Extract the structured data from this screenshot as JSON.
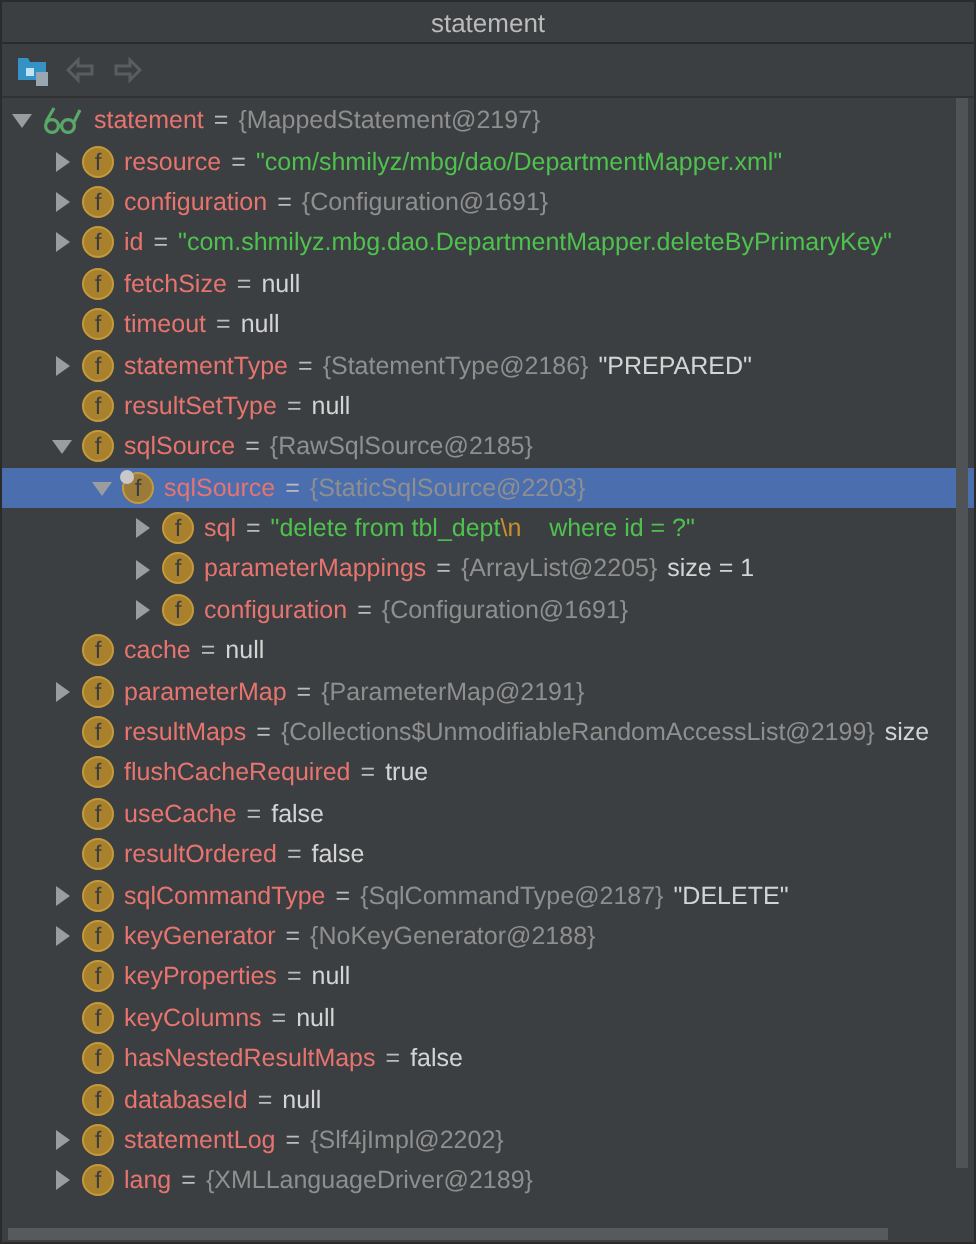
{
  "window": {
    "title": "statement"
  },
  "toolbar": {
    "buttons": [
      {
        "kind": "frames",
        "disabled": false
      },
      {
        "kind": "back",
        "disabled": true
      },
      {
        "kind": "forward",
        "disabled": true
      }
    ]
  },
  "tree": {
    "items": [
      {
        "kind": "node",
        "expanded": true,
        "selected": false,
        "icon": {
          "kind": "watch"
        },
        "parts": [
          {
            "kind": "name",
            "text": "statement"
          },
          {
            "kind": "op",
            "text": "="
          },
          {
            "kind": "ref",
            "text": "{MappedStatement@2197}"
          }
        ],
        "children": [
          {
            "kind": "node",
            "expanded": false,
            "selected": false,
            "icon": {
              "kind": "field",
              "letter": "f"
            },
            "parts": [
              {
                "kind": "name",
                "text": "resource"
              },
              {
                "kind": "op",
                "text": "="
              },
              {
                "kind": "string",
                "text": "\"com/shmilyz/mbg/dao/DepartmentMapper.xml\""
              }
            ]
          },
          {
            "kind": "node",
            "expanded": false,
            "selected": false,
            "icon": {
              "kind": "field",
              "letter": "f"
            },
            "parts": [
              {
                "kind": "name",
                "text": "configuration"
              },
              {
                "kind": "op",
                "text": "="
              },
              {
                "kind": "ref",
                "text": "{Configuration@1691}"
              }
            ]
          },
          {
            "kind": "node",
            "expanded": false,
            "selected": false,
            "icon": {
              "kind": "field",
              "letter": "f"
            },
            "parts": [
              {
                "kind": "name",
                "text": "id"
              },
              {
                "kind": "op",
                "text": "="
              },
              {
                "kind": "string",
                "text": "\"com.shmilyz.mbg.dao.DepartmentMapper.deleteByPrimaryKey\""
              }
            ]
          },
          {
            "kind": "leaf",
            "selected": false,
            "icon": {
              "kind": "field",
              "letter": "f"
            },
            "parts": [
              {
                "kind": "name",
                "text": "fetchSize"
              },
              {
                "kind": "op",
                "text": "="
              },
              {
                "kind": "literal",
                "text": "null"
              }
            ]
          },
          {
            "kind": "leaf",
            "selected": false,
            "icon": {
              "kind": "field",
              "letter": "f"
            },
            "parts": [
              {
                "kind": "name",
                "text": "timeout"
              },
              {
                "kind": "op",
                "text": "="
              },
              {
                "kind": "literal",
                "text": "null"
              }
            ]
          },
          {
            "kind": "node",
            "expanded": false,
            "selected": false,
            "icon": {
              "kind": "field",
              "letter": "f"
            },
            "parts": [
              {
                "kind": "name",
                "text": "statementType"
              },
              {
                "kind": "op",
                "text": "="
              },
              {
                "kind": "ref",
                "text": "{StatementType@2186}"
              },
              {
                "kind": "literal",
                "text": "\"PREPARED\""
              }
            ]
          },
          {
            "kind": "leaf",
            "selected": false,
            "icon": {
              "kind": "field",
              "letter": "f"
            },
            "parts": [
              {
                "kind": "name",
                "text": "resultSetType"
              },
              {
                "kind": "op",
                "text": "="
              },
              {
                "kind": "literal",
                "text": "null"
              }
            ]
          },
          {
            "kind": "node",
            "expanded": true,
            "selected": false,
            "icon": {
              "kind": "field",
              "letter": "f"
            },
            "parts": [
              {
                "kind": "name",
                "text": "sqlSource"
              },
              {
                "kind": "op",
                "text": "="
              },
              {
                "kind": "ref",
                "text": "{RawSqlSource@2185}"
              }
            ],
            "children": [
              {
                "kind": "node",
                "expanded": true,
                "selected": true,
                "icon": {
                  "kind": "field",
                  "letter": "f",
                  "marked": true
                },
                "parts": [
                  {
                    "kind": "name",
                    "text": "sqlSource"
                  },
                  {
                    "kind": "op",
                    "text": "="
                  },
                  {
                    "kind": "ref",
                    "text": "{StaticSqlSource@2203}"
                  }
                ],
                "children": [
                  {
                    "kind": "node",
                    "expanded": false,
                    "selected": false,
                    "icon": {
                      "kind": "field",
                      "letter": "f"
                    },
                    "parts": [
                      {
                        "kind": "name",
                        "text": "sql"
                      },
                      {
                        "kind": "op",
                        "text": "="
                      },
                      {
                        "kind": "string",
                        "text": "\"delete from tbl_dept"
                      },
                      {
                        "kind": "escape",
                        "text": "\\n"
                      },
                      {
                        "kind": "string",
                        "text": "    where id = ?\""
                      }
                    ]
                  },
                  {
                    "kind": "node",
                    "expanded": false,
                    "selected": false,
                    "icon": {
                      "kind": "field",
                      "letter": "f"
                    },
                    "parts": [
                      {
                        "kind": "name",
                        "text": "parameterMappings"
                      },
                      {
                        "kind": "op",
                        "text": "="
                      },
                      {
                        "kind": "ref",
                        "text": "{ArrayList@2205}"
                      },
                      {
                        "kind": "literal",
                        "text": "size = 1"
                      }
                    ]
                  },
                  {
                    "kind": "node",
                    "expanded": false,
                    "selected": false,
                    "icon": {
                      "kind": "field",
                      "letter": "f"
                    },
                    "parts": [
                      {
                        "kind": "name",
                        "text": "configuration"
                      },
                      {
                        "kind": "op",
                        "text": "="
                      },
                      {
                        "kind": "ref",
                        "text": "{Configuration@1691}"
                      }
                    ]
                  }
                ]
              }
            ]
          },
          {
            "kind": "leaf",
            "selected": false,
            "icon": {
              "kind": "field",
              "letter": "f"
            },
            "parts": [
              {
                "kind": "name",
                "text": "cache"
              },
              {
                "kind": "op",
                "text": "="
              },
              {
                "kind": "literal",
                "text": "null"
              }
            ]
          },
          {
            "kind": "node",
            "expanded": false,
            "selected": false,
            "icon": {
              "kind": "field",
              "letter": "f"
            },
            "parts": [
              {
                "kind": "name",
                "text": "parameterMap"
              },
              {
                "kind": "op",
                "text": "="
              },
              {
                "kind": "ref",
                "text": "{ParameterMap@2191}"
              }
            ]
          },
          {
            "kind": "leaf",
            "selected": false,
            "icon": {
              "kind": "field",
              "letter": "f"
            },
            "parts": [
              {
                "kind": "name",
                "text": "resultMaps"
              },
              {
                "kind": "op",
                "text": "="
              },
              {
                "kind": "ref",
                "text": "{Collections$UnmodifiableRandomAccessList@2199}"
              },
              {
                "kind": "literal",
                "text": "size"
              }
            ]
          },
          {
            "kind": "leaf",
            "selected": false,
            "icon": {
              "kind": "field",
              "letter": "f"
            },
            "parts": [
              {
                "kind": "name",
                "text": "flushCacheRequired"
              },
              {
                "kind": "op",
                "text": "="
              },
              {
                "kind": "literal",
                "text": "true"
              }
            ]
          },
          {
            "kind": "leaf",
            "selected": false,
            "icon": {
              "kind": "field",
              "letter": "f"
            },
            "parts": [
              {
                "kind": "name",
                "text": "useCache"
              },
              {
                "kind": "op",
                "text": "="
              },
              {
                "kind": "literal",
                "text": "false"
              }
            ]
          },
          {
            "kind": "leaf",
            "selected": false,
            "icon": {
              "kind": "field",
              "letter": "f"
            },
            "parts": [
              {
                "kind": "name",
                "text": "resultOrdered"
              },
              {
                "kind": "op",
                "text": "="
              },
              {
                "kind": "literal",
                "text": "false"
              }
            ]
          },
          {
            "kind": "node",
            "expanded": false,
            "selected": false,
            "icon": {
              "kind": "field",
              "letter": "f"
            },
            "parts": [
              {
                "kind": "name",
                "text": "sqlCommandType"
              },
              {
                "kind": "op",
                "text": "="
              },
              {
                "kind": "ref",
                "text": "{SqlCommandType@2187}"
              },
              {
                "kind": "literal",
                "text": "\"DELETE\""
              }
            ]
          },
          {
            "kind": "node",
            "expanded": false,
            "selected": false,
            "icon": {
              "kind": "field",
              "letter": "f"
            },
            "parts": [
              {
                "kind": "name",
                "text": "keyGenerator"
              },
              {
                "kind": "op",
                "text": "="
              },
              {
                "kind": "ref",
                "text": "{NoKeyGenerator@2188}"
              }
            ]
          },
          {
            "kind": "leaf",
            "selected": false,
            "icon": {
              "kind": "field",
              "letter": "f"
            },
            "parts": [
              {
                "kind": "name",
                "text": "keyProperties"
              },
              {
                "kind": "op",
                "text": "="
              },
              {
                "kind": "literal",
                "text": "null"
              }
            ]
          },
          {
            "kind": "leaf",
            "selected": false,
            "icon": {
              "kind": "field",
              "letter": "f"
            },
            "parts": [
              {
                "kind": "name",
                "text": "keyColumns"
              },
              {
                "kind": "op",
                "text": "="
              },
              {
                "kind": "literal",
                "text": "null"
              }
            ]
          },
          {
            "kind": "leaf",
            "selected": false,
            "icon": {
              "kind": "field",
              "letter": "f"
            },
            "parts": [
              {
                "kind": "name",
                "text": "hasNestedResultMaps"
              },
              {
                "kind": "op",
                "text": "="
              },
              {
                "kind": "literal",
                "text": "false"
              }
            ]
          },
          {
            "kind": "leaf",
            "selected": false,
            "icon": {
              "kind": "field",
              "letter": "f"
            },
            "parts": [
              {
                "kind": "name",
                "text": "databaseId"
              },
              {
                "kind": "op",
                "text": "="
              },
              {
                "kind": "literal",
                "text": "null"
              }
            ]
          },
          {
            "kind": "node",
            "expanded": false,
            "selected": false,
            "icon": {
              "kind": "field",
              "letter": "f"
            },
            "parts": [
              {
                "kind": "name",
                "text": "statementLog"
              },
              {
                "kind": "op",
                "text": "="
              },
              {
                "kind": "ref",
                "text": "{Slf4jImpl@2202}"
              }
            ]
          },
          {
            "kind": "node",
            "expanded": false,
            "selected": false,
            "icon": {
              "kind": "field",
              "letter": "f"
            },
            "parts": [
              {
                "kind": "name",
                "text": "lang"
              },
              {
                "kind": "op",
                "text": "="
              },
              {
                "kind": "ref",
                "text": "{XMLLanguageDriver@2189}"
              }
            ]
          }
        ]
      }
    ]
  }
}
